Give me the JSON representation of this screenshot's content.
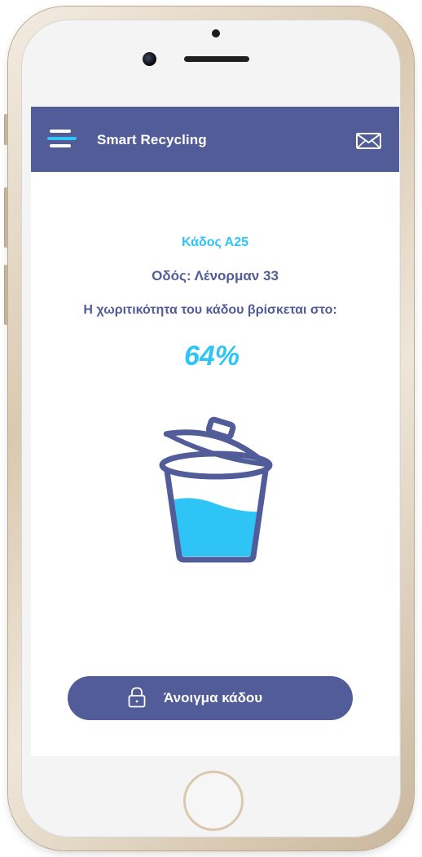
{
  "appbar": {
    "title": "Smart Recycling",
    "menu_icon": "hamburger-menu-icon",
    "mail_icon": "envelope-icon"
  },
  "bin": {
    "name": "Κάδος Α25",
    "street": "Οδός: Λένορμαν 33",
    "capacity_label": "Η χωριτικότητα του κάδου βρίσκεται στο:",
    "percent_text": "64%",
    "fill_level": 0.64
  },
  "open_button": {
    "label": "Άνοιγμα κάδου",
    "icon": "lock-icon"
  },
  "colors": {
    "primary": "#525c99",
    "accent": "#2ec4f5",
    "background": "#ffffff"
  }
}
